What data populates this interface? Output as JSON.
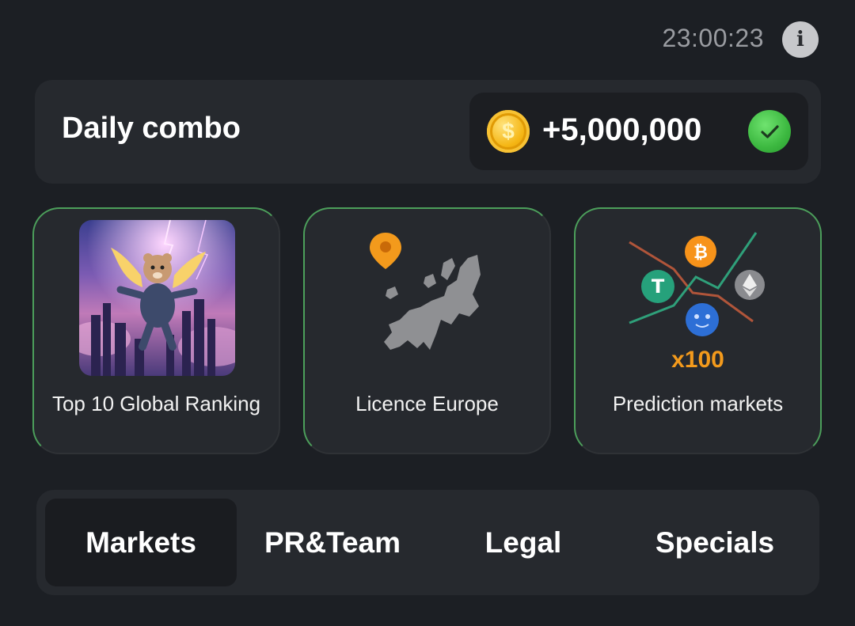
{
  "header": {
    "timer": "23:00:23",
    "info_icon": "info-icon"
  },
  "combo": {
    "title": "Daily combo",
    "reward": "+5,000,000",
    "coin_icon": "coin-icon",
    "status_icon": "check-icon"
  },
  "cards": [
    {
      "label": "Top 10 Global Ranking",
      "image": "hamster-astronaut-image"
    },
    {
      "label": "Licence Europe",
      "image": "europe-map-pin-image"
    },
    {
      "label": "Prediction markets",
      "image": "crypto-chart-image",
      "badge": "x100"
    }
  ],
  "tabs": [
    {
      "label": "Markets",
      "active": true
    },
    {
      "label": "PR&Team",
      "active": false
    },
    {
      "label": "Legal",
      "active": false
    },
    {
      "label": "Specials",
      "active": false
    }
  ],
  "colors": {
    "accent_green": "#57b36a",
    "coin_gold": "#f5b614",
    "badge_orange": "#f39a1c"
  }
}
